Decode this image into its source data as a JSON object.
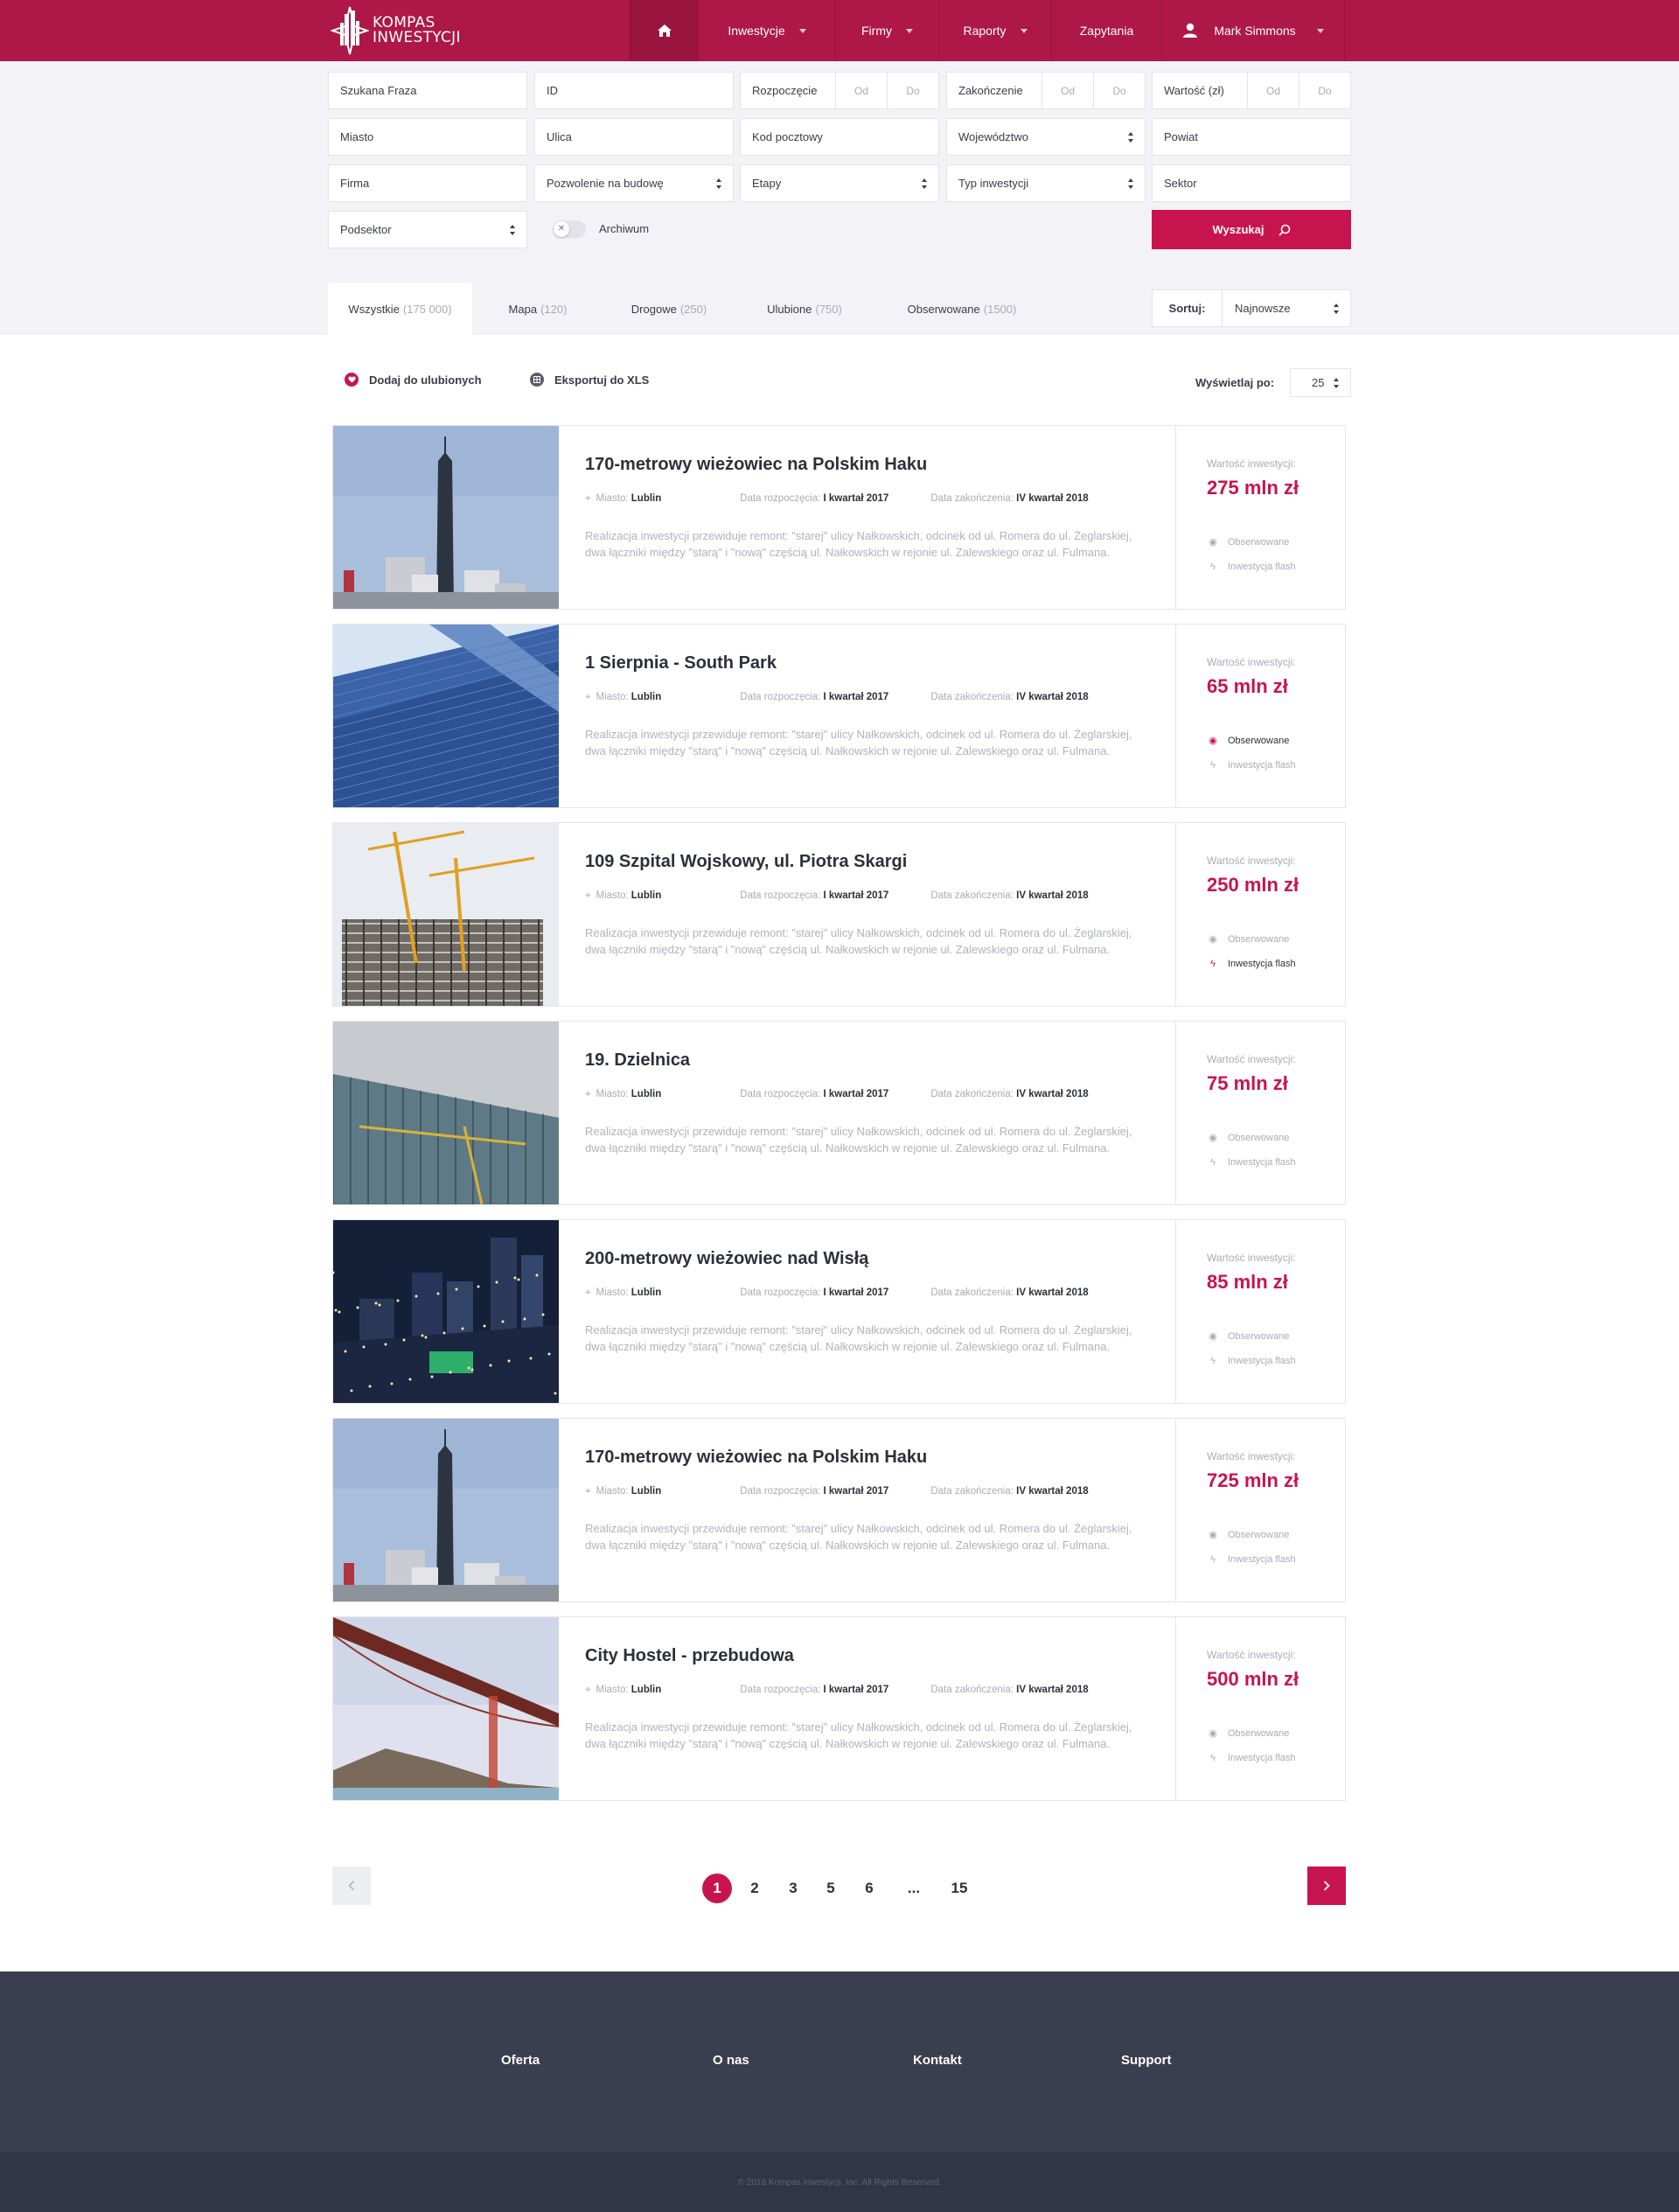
{
  "brand": {
    "name_line1": "KOMPAS",
    "name_line2": "INWESTYCJI",
    "logo_icon": "kompas-logo"
  },
  "nav": {
    "home_icon": "home-icon",
    "items": [
      {
        "label": "Inwestycje"
      },
      {
        "label": "Firmy"
      },
      {
        "label": "Raporty"
      },
      {
        "label": "Zapytania"
      }
    ],
    "user": {
      "name": "Mark Simmons",
      "icon": "user-icon"
    }
  },
  "filters": {
    "phrase": "Szukana Fraza",
    "id": "ID",
    "start": {
      "label": "Rozpoczęcie",
      "from": "Od",
      "to": "Do"
    },
    "end": {
      "label": "Zakończenie",
      "from": "Od",
      "to": "Do"
    },
    "value": {
      "label": "Wartość (zł)",
      "from": "Od",
      "to": "Do"
    },
    "city": "Miasto",
    "street": "Ulica",
    "postcode": "Kod pocztowy",
    "voivodeship": "Województwo",
    "county": "Powiat",
    "company": "Firma",
    "permit": "Pozwolenie na budowę",
    "stages": "Etapy",
    "investment_type": "Typ inwestycji",
    "sector": "Sektor",
    "subsector": "Podsektor",
    "archive": "Archiwum",
    "search_button": "Wyszukaj"
  },
  "tabs": [
    {
      "label": "Wszystkie",
      "count": "(175 000)"
    },
    {
      "label": "Mapa",
      "count": "(120)"
    },
    {
      "label": "Drogowe",
      "count": "(250)"
    },
    {
      "label": "Ulubione",
      "count": "(750)"
    },
    {
      "label": "Obserwowane",
      "count": "(1500)"
    }
  ],
  "sort": {
    "label": "Sortuj:",
    "value": "Najnowsze"
  },
  "toolbar": {
    "favorites": "Dodaj do ulubionych",
    "export": "Eksportuj do XLS",
    "per_page_label": "Wyświetlaj po:",
    "per_page_value": "25"
  },
  "labels": {
    "city": "Miasto:",
    "start_date": "Data rozpoczęcia:",
    "end_date": "Data zakończenia:",
    "value": "Wartość inwestycji:",
    "observed": "Obserwowane",
    "flash": "Inwestycja flash"
  },
  "colors": {
    "brand": "#ad1849",
    "accent": "#c8144e",
    "footer": "#3b3e4e"
  },
  "investments": [
    {
      "title": "170-metrowy wieżowiec na Polskim Haku",
      "city": "Lublin",
      "start": "I kwartał 2017",
      "end": "IV kwartał 2018",
      "description": "Realizacja inwestycji przewiduje remont: \"starej\" ulicy Nałkowskich, odcinek od ul. Romera do ul. Żeglarskiej, dwa łączniki między \"starą\" i \"nową\" częścią ul. Nałkowskich w rejonie ul. Zalewskiego oraz ul. Fulmana.",
      "value": "275 mln zł",
      "observed": false,
      "flash": false
    },
    {
      "title": "1 Sierpnia - South Park",
      "city": "Lublin",
      "start": "I kwartał 2017",
      "end": "IV kwartał 2018",
      "description": "Realizacja inwestycji przewiduje remont: \"starej\" ulicy Nałkowskich, odcinek od ul. Romera do ul. Żeglarskiej, dwa łączniki między \"starą\" i \"nową\" częścią ul. Nałkowskich w rejonie ul. Zalewskiego oraz ul. Fulmana.",
      "value": "65 mln zł",
      "observed": true,
      "flash": false
    },
    {
      "title": "109 Szpital Wojskowy, ul. Piotra Skargi",
      "city": "Lublin",
      "start": "I kwartał 2017",
      "end": "IV kwartał 2018",
      "description": "Realizacja inwestycji przewiduje remont: \"starej\" ulicy Nałkowskich, odcinek od ul. Romera do ul. Żeglarskiej, dwa łączniki między \"starą\" i \"nową\" częścią ul. Nałkowskich w rejonie ul. Zalewskiego oraz ul. Fulmana.",
      "value": "250 mln zł",
      "observed": false,
      "flash": true
    },
    {
      "title": "19. Dzielnica",
      "city": "Lublin",
      "start": "I kwartał 2017",
      "end": "IV kwartał 2018",
      "description": "Realizacja inwestycji przewiduje remont: \"starej\" ulicy Nałkowskich, odcinek od ul. Romera do ul. Żeglarskiej, dwa łączniki między \"starą\" i \"nową\" częścią ul. Nałkowskich w rejonie ul. Zalewskiego oraz ul. Fulmana.",
      "value": "75 mln zł",
      "observed": false,
      "flash": false
    },
    {
      "title": "200-metrowy wieżowiec nad Wisłą",
      "city": "Lublin",
      "start": "I kwartał 2017",
      "end": "IV kwartał 2018",
      "description": "Realizacja inwestycji przewiduje remont: \"starej\" ulicy Nałkowskich, odcinek od ul. Romera do ul. Żeglarskiej, dwa łączniki między \"starą\" i \"nową\" częścią ul. Nałkowskich w rejonie ul. Zalewskiego oraz ul. Fulmana.",
      "value": "85 mln zł",
      "observed": false,
      "flash": false
    },
    {
      "title": "170-metrowy wieżowiec na Polskim Haku",
      "city": "Lublin",
      "start": "I kwartał 2017",
      "end": "IV kwartał 2018",
      "description": "Realizacja inwestycji przewiduje remont: \"starej\" ulicy Nałkowskich, odcinek od ul. Romera do ul. Żeglarskiej, dwa łączniki między \"starą\" i \"nową\" częścią ul. Nałkowskich w rejonie ul. Zalewskiego oraz ul. Fulmana.",
      "value": "725 mln zł",
      "observed": false,
      "flash": false
    },
    {
      "title": "City Hostel - przebudowa",
      "city": "Lublin",
      "start": "I kwartał 2017",
      "end": "IV kwartał 2018",
      "description": "Realizacja inwestycji przewiduje remont: \"starej\" ulicy Nałkowskich, odcinek od ul. Romera do ul. Żeglarskiej, dwa łączniki między \"starą\" i \"nową\" częścią ul. Nałkowskich w rejonie ul. Zalewskiego oraz ul. Fulmana.",
      "value": "500 mln zł",
      "observed": false,
      "flash": false
    }
  ],
  "pagination": {
    "pages": [
      "1",
      "2",
      "3",
      "5",
      "6",
      "...",
      "15"
    ],
    "current": "1"
  },
  "footer": {
    "links": [
      "Oferta",
      "O nas",
      "Kontakt",
      "Support"
    ],
    "copyright": "© 2016 Kompas Inwestycji, Inc. All Rights Reserved."
  }
}
